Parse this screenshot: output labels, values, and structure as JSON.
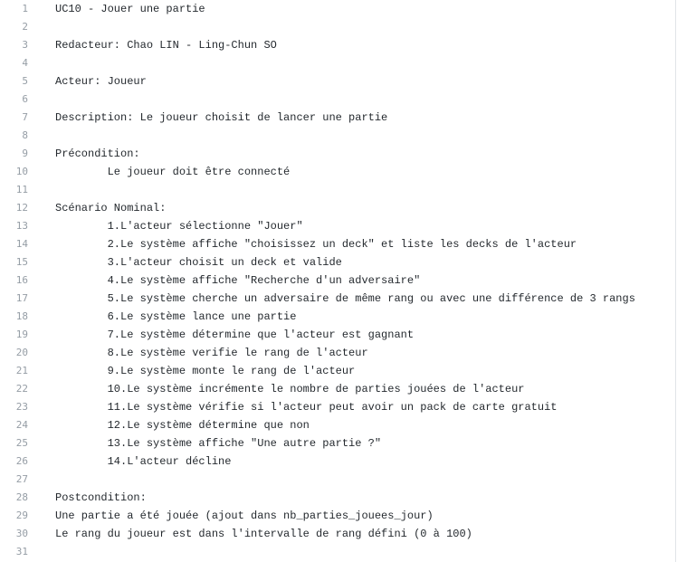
{
  "file": {
    "lines": [
      "UC10 - Jouer une partie",
      "",
      "Redacteur: Chao LIN - Ling-Chun SO",
      "",
      "Acteur: Joueur",
      "",
      "Description: Le joueur choisit de lancer une partie",
      "",
      "Précondition:",
      "\tLe joueur doit être connecté",
      "",
      "Scénario Nominal:",
      "\t1.L'acteur sélectionne \"Jouer\"",
      "\t2.Le système affiche \"choisissez un deck\" et liste les decks de l'acteur",
      "\t3.L'acteur choisit un deck et valide",
      "\t4.Le système affiche \"Recherche d'un adversaire\"",
      "\t5.Le système cherche un adversaire de même rang ou avec une différence de 3 rangs",
      "\t6.Le système lance une partie",
      "\t7.Le système détermine que l'acteur est gagnant",
      "\t8.Le système verifie le rang de l'acteur",
      "\t9.Le système monte le rang de l'acteur",
      "\t10.Le système incrémente le nombre de parties jouées de l'acteur",
      "\t11.Le système vérifie si l'acteur peut avoir un pack de carte gratuit",
      "\t12.Le système détermine que non",
      "\t13.Le système affiche \"Une autre partie ?\"",
      "\t14.L'acteur décline",
      "",
      "Postcondition:",
      "Une partie a été jouée (ajout dans nb_parties_jouees_jour)",
      "Le rang du joueur est dans l'intervalle de rang défini (0 à 100)",
      ""
    ]
  }
}
